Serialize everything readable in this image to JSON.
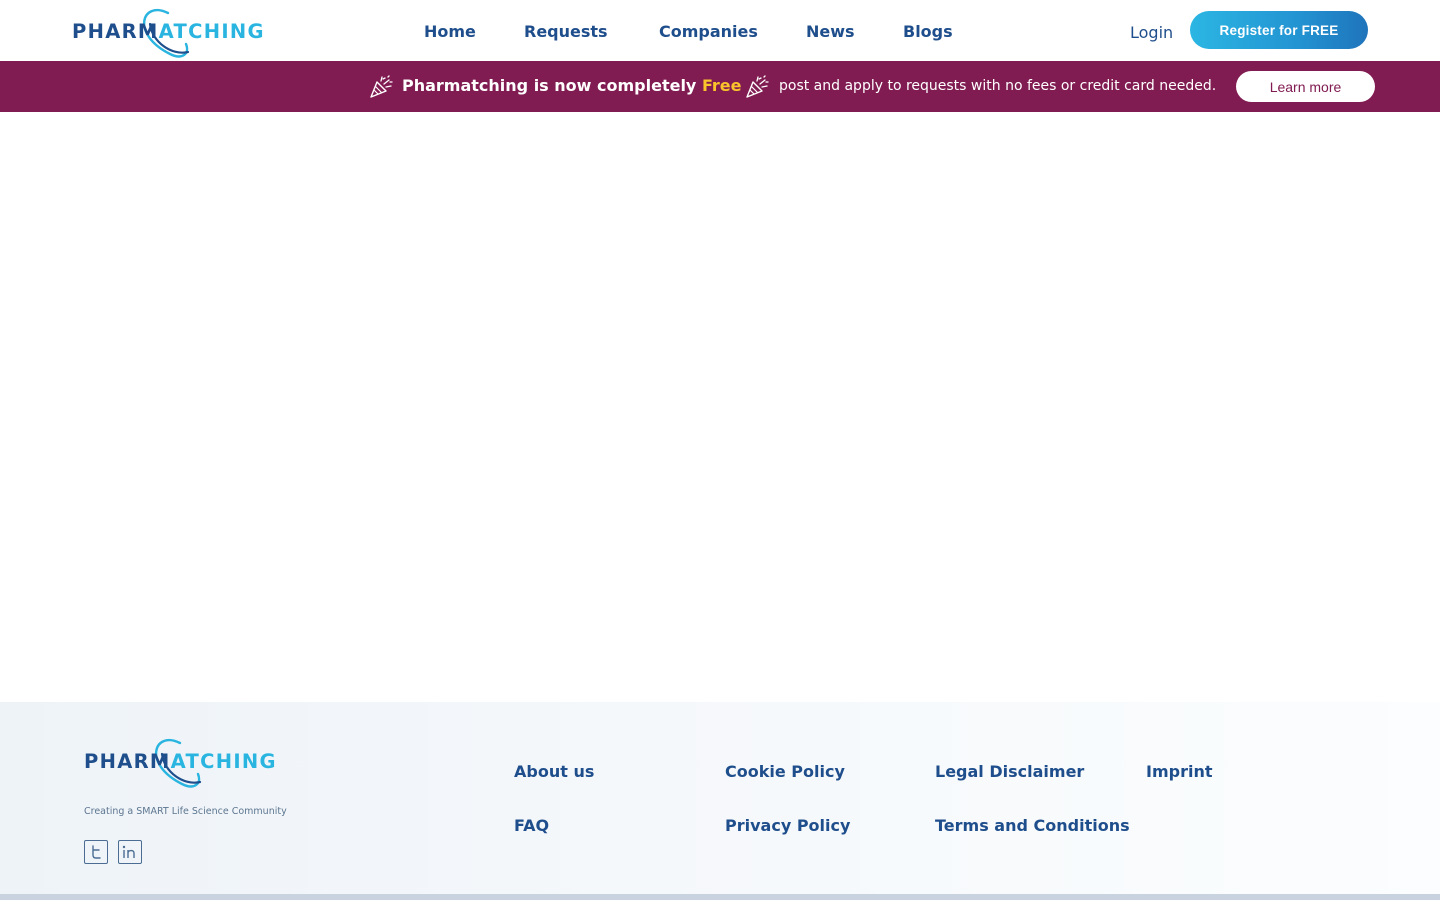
{
  "brand": {
    "logo_part1": "PHAR",
    "logo_part2": "M",
    "logo_part3": "ATCHING",
    "colors": {
      "navy": "#1f4e8c",
      "cyan": "#2ab4e0",
      "banner": "#801c52",
      "highlight": "#f9c32b"
    }
  },
  "nav": {
    "items": [
      {
        "label": "Home"
      },
      {
        "label": "Requests"
      },
      {
        "label": "Companies"
      },
      {
        "label": "News"
      },
      {
        "label": "Blogs"
      }
    ],
    "login": "Login",
    "register": "Register for FREE"
  },
  "banner": {
    "headline": "Pharmatching is now completely",
    "highlight": "Free",
    "subtext": "post and apply to requests with no fees or credit card needed.",
    "cta": "Learn more",
    "icon": "party-popper-icon"
  },
  "footer": {
    "tagline": "Creating a SMART Life Science Community",
    "social": [
      {
        "icon": "twitter-icon"
      },
      {
        "icon": "linkedin-icon"
      }
    ],
    "links": [
      {
        "label": "About us"
      },
      {
        "label": "Cookie Policy"
      },
      {
        "label": "Legal Disclaimer"
      },
      {
        "label": "Imprint"
      },
      {
        "label": "FAQ"
      },
      {
        "label": "Privacy Policy"
      },
      {
        "label": "Terms and Conditions"
      }
    ]
  }
}
